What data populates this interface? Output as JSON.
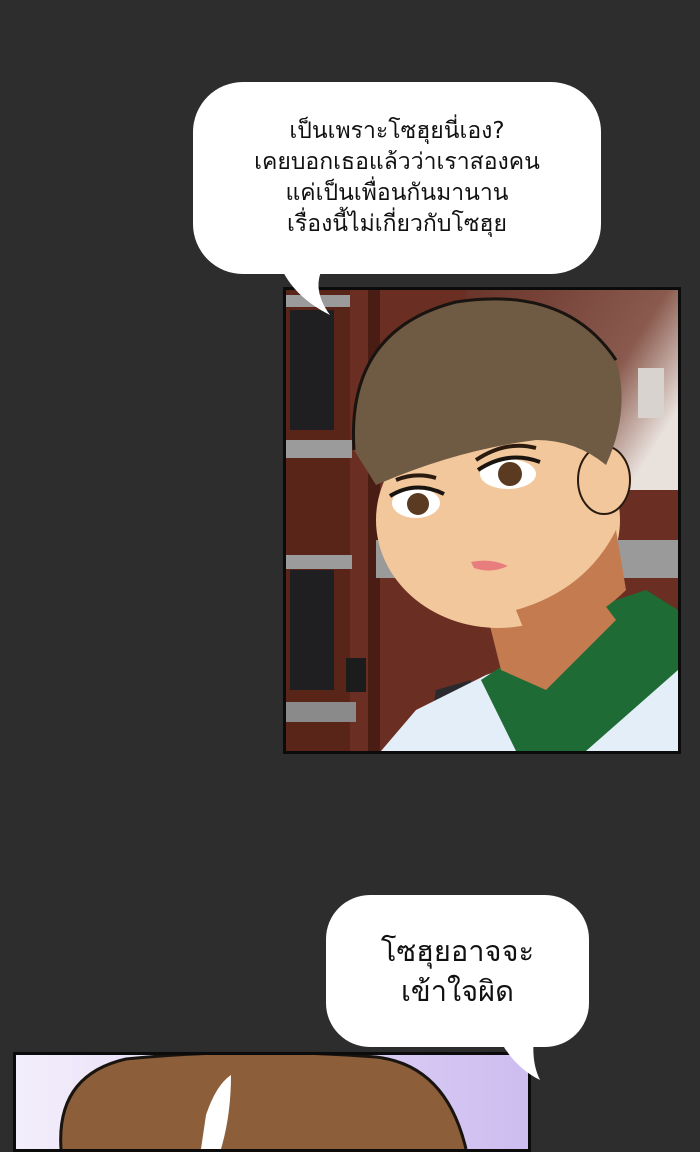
{
  "speech_bubbles": [
    {
      "lines": [
        "เป็นเพราะโซฮุยนี่เอง?",
        "เคยบอกเธอแล้วว่าเราสองคน",
        "แค่เป็นเพื่อนกันมานาน",
        "เรื่องนี้ไม่เกี่ยวกับโซฮุย"
      ]
    },
    {
      "lines": [
        "โซฮุยอาจจะ",
        "เข้าใจผิด"
      ]
    }
  ],
  "colors": {
    "background": "#2d2d2d",
    "bubble": "#ffffff",
    "panel_border": "#0b0b0b"
  }
}
